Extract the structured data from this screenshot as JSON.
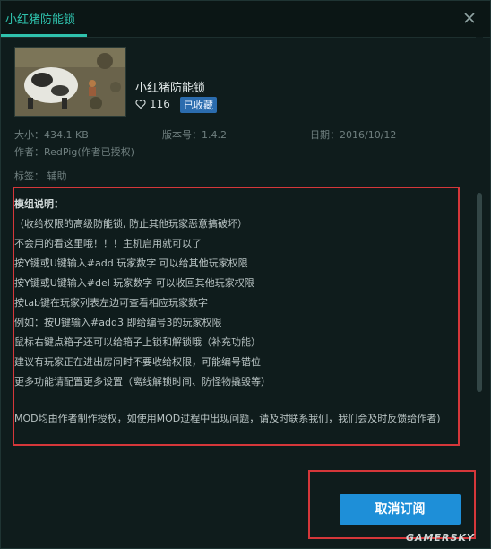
{
  "header": {
    "tab_title": "小红猪防能锁",
    "close_icon": "close-icon"
  },
  "mod": {
    "title": "小红猪防能锁",
    "likes": "116",
    "favorited_badge": "已收藏"
  },
  "meta": {
    "size": "大小：434.1 KB",
    "version": "版本号：1.4.2",
    "date": "日期：2016/10/12",
    "author": "作者：RedPig(作者已授权)",
    "tags": "标签：  辅助"
  },
  "description": {
    "heading": "模组说明：",
    "lines": [
      "（收给权限的高级防能锁, 防止其他玩家恶意搞破坏）",
      "不会用的看这里哦！！！主机启用就可以了",
      "按Y键或U键输入#add  玩家数字 可以给其他玩家权限",
      "按Y键或U键输入#del  玩家数字 可以收回其他玩家权限",
      "按tab键在玩家列表左边可查看相应玩家数字",
      "例如：按U键输入#add3  即给编号3的玩家权限",
      "鼠标右键点箱子还可以给箱子上锁和解锁哦（补充功能）",
      "建议有玩家正在进出房间时不要收给权限，可能编号错位",
      "更多功能请配置更多设置（离线解锁时间、防怪物撬毁等）"
    ],
    "notice": "MOD均由作者制作授权，如使用MOD过程中出现问题，请及时联系我们，我们会及时反馈给作者)"
  },
  "actions": {
    "unsubscribe_label": "取消订阅"
  },
  "watermark": "GAMERSKY"
}
